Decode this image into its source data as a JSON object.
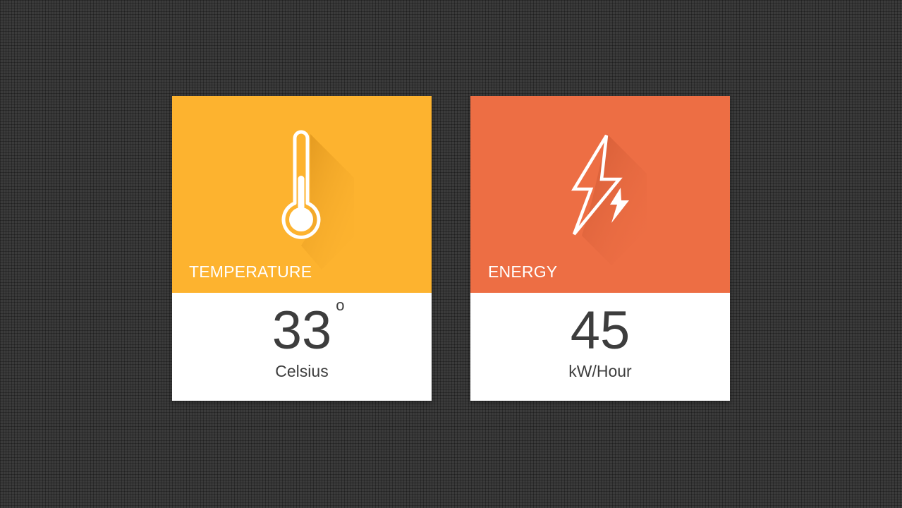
{
  "cards": [
    {
      "label": "TEMPERATURE",
      "value": "33",
      "degree_symbol": "o",
      "unit": "Celsius",
      "icon": "thermometer-icon",
      "color": "#fdb32f"
    },
    {
      "label": "ENERGY",
      "value": "45",
      "unit": "kW/Hour",
      "icon": "lightning-bolt-icon",
      "color": "#ed6e44"
    }
  ],
  "colors": {
    "background": "#3b3b3b",
    "card_bottom": "#ffffff",
    "value_text": "#3d3d3d"
  }
}
